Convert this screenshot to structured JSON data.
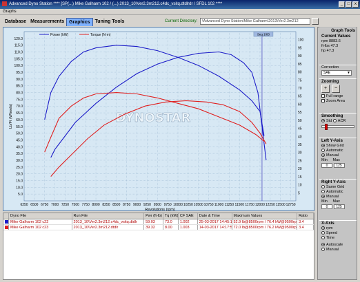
{
  "window": {
    "title": "Advanced Dyno Station **** [SP(...) Mike Galharm 102 / (...) 2013_10\\Ver2.3m212.c4dc_vsitq.dtdlrdr / SFDL 102 ****",
    "buttons": [
      "_",
      "□",
      "x"
    ]
  },
  "menu": {
    "item": "Graphs"
  },
  "tabs": [
    "Database",
    "Measurements",
    "Graphics",
    "Tuning Tools"
  ],
  "active_tab": "Graphics",
  "current_directory": {
    "label": "Current Directory:",
    "value": "\\Advanced Dyno Station\\Mike Galharm\\2013\\Ver2.3m212"
  },
  "chart_data": {
    "type": "line",
    "x_label": "Revolutions (rpm)",
    "y_left_label": "Lb/Ft (Wheels)",
    "x_ticks": [
      "6250",
      "6500",
      "6750",
      "7000",
      "7250",
      "7500",
      "7750",
      "8000",
      "8250",
      "8500",
      "8750",
      "9000",
      "9250",
      "9500",
      "9750",
      "10000",
      "10250",
      "10500",
      "10750",
      "11000",
      "11250",
      "11500",
      "11750",
      "12000",
      "12250",
      "12500",
      "12750"
    ],
    "y_ticks": [
      "120.0",
      "115.0",
      "110.0",
      "105.0",
      "100.0",
      "95.0",
      "90.0",
      "85.0",
      "80.0",
      "75.0",
      "70.0",
      "65.0",
      "60.0",
      "55.0",
      "50.0",
      "45.0",
      "40.0",
      "35.0",
      "30.0",
      "25.0",
      "20.0",
      "15.0",
      "10.0",
      "5.0"
    ],
    "y_right_ticks": [
      "100",
      "95",
      "90",
      "85",
      "80",
      "75",
      "70",
      "65",
      "60",
      "55",
      "50",
      "45",
      "40",
      "35",
      "30",
      "25",
      "20",
      "15",
      "10",
      "5"
    ],
    "y_range": [
      0,
      125
    ],
    "x_range": [
      6250,
      12875
    ],
    "legend": [
      "Power (kW)",
      "Torque (N·m)"
    ],
    "cursor_label": "Seq 1/83",
    "cursor_x": 12050,
    "watermark": "DYNOSTAR",
    "series": [
      {
        "name": "Mike Galharm 102 c22 power",
        "color": "#1c1cc8",
        "x": [
          6900,
          7000,
          7200,
          7500,
          8000,
          8500,
          9000,
          9500,
          10000,
          10500,
          11000,
          11300,
          11600,
          11800,
          11950,
          12050,
          12150
        ],
        "y": [
          32,
          38,
          46,
          58,
          72,
          84,
          94,
          101,
          106,
          109,
          110,
          108,
          102,
          95,
          80,
          55,
          30
        ]
      },
      {
        "name": "Mike Galharm 102 c22 torque",
        "color": "#1c1cc8",
        "x": [
          6750,
          6900,
          7100,
          7400,
          7700,
          8000,
          8500,
          9000,
          9500,
          10000,
          10500,
          11000,
          11500,
          11800,
          12000,
          12100
        ],
        "y": [
          60,
          80,
          92,
          103,
          110,
          113,
          115,
          114,
          111,
          106,
          100,
          92,
          82,
          74,
          66,
          48
        ]
      },
      {
        "name": "Mike Galharm 102 c23 power",
        "color": "#e02020",
        "x": [
          6900,
          7100,
          7400,
          7800,
          8200,
          8700,
          9200,
          9700,
          10200,
          10700,
          11100,
          11500,
          11800,
          12000,
          12150
        ],
        "y": [
          18,
          25,
          34,
          46,
          56,
          64,
          70,
          73,
          74,
          73,
          71,
          66,
          58,
          50,
          42
        ]
      },
      {
        "name": "Mike Galharm 102 c23 torque",
        "color": "#e02020",
        "x": [
          6750,
          6900,
          7100,
          7400,
          7700,
          8000,
          8500,
          9000,
          9500,
          10000,
          10500,
          11000,
          11500,
          11900,
          12100
        ],
        "y": [
          36,
          47,
          61,
          70,
          76,
          79,
          80,
          79,
          76,
          72,
          68,
          62,
          56,
          49,
          44
        ]
      }
    ]
  },
  "sidebar": {
    "graph_tools": "Graph Tools",
    "current_values": "Current Values",
    "values": [
      "rpm 8883.6",
      "ft-lbs 47.3",
      "hp 47.3"
    ],
    "correction_label": "Correction",
    "correction_value": "SAE",
    "zooming": "Zooming",
    "zoom_in": "+",
    "zoom_out": "−",
    "full_range": "Full range",
    "zoom_area": "Zoom Area",
    "smoothing": "Smoothing",
    "smooth_options": [
      "Std",
      "ACR"
    ],
    "left_axis": "Left Y-Axis",
    "left_opts": [
      "Show Grid",
      "Automatic",
      "Manual"
    ],
    "left_min_label": "Min",
    "left_max_label": "Max",
    "left_min": "0",
    "left_max": "125",
    "right_axis": "Right Y-Axis",
    "right_opts": [
      "Same Grid",
      "Automatic",
      "Manual"
    ],
    "right_min_label": "Min",
    "right_max_label": "Max",
    "right_min": "0",
    "right_max": "125",
    "x_axis": "X-Axis",
    "x_opts": [
      "rpm",
      "Speed",
      "Time"
    ],
    "x_extra": [
      "Autoscale",
      "Manual"
    ]
  },
  "table": {
    "headers": [
      "",
      "Dyno File",
      "Run File",
      "Pwr (ft-lb)",
      "Tq (kW)",
      "CF SAE",
      "Date & Time",
      "Maximum Values",
      "Ratio"
    ],
    "rows": [
      {
        "color": "#1c1cc8",
        "cells": [
          "",
          "Mike Galharm 102 c22",
          "2013_10\\Ver2.3m212.c4dc_vsitq.dtdlr",
          "59.03",
          "73.0",
          "1.002",
          "25-03-2017 14:45:18",
          "52.9 lb@8500rpm / 76.4 kW@9500rpm",
          "3.4"
        ]
      },
      {
        "color": "#e02020",
        "cells": [
          "",
          "Mike Galharm 102 c23",
          "2013_10\\Ver2.3m212.dtdlr",
          "39.32",
          "8.00",
          "1.003",
          "14-03-2017 14:17:55",
          "72.0 lb@8500rpm / 76.2 kW@9500rpm",
          "3.4"
        ]
      }
    ]
  }
}
